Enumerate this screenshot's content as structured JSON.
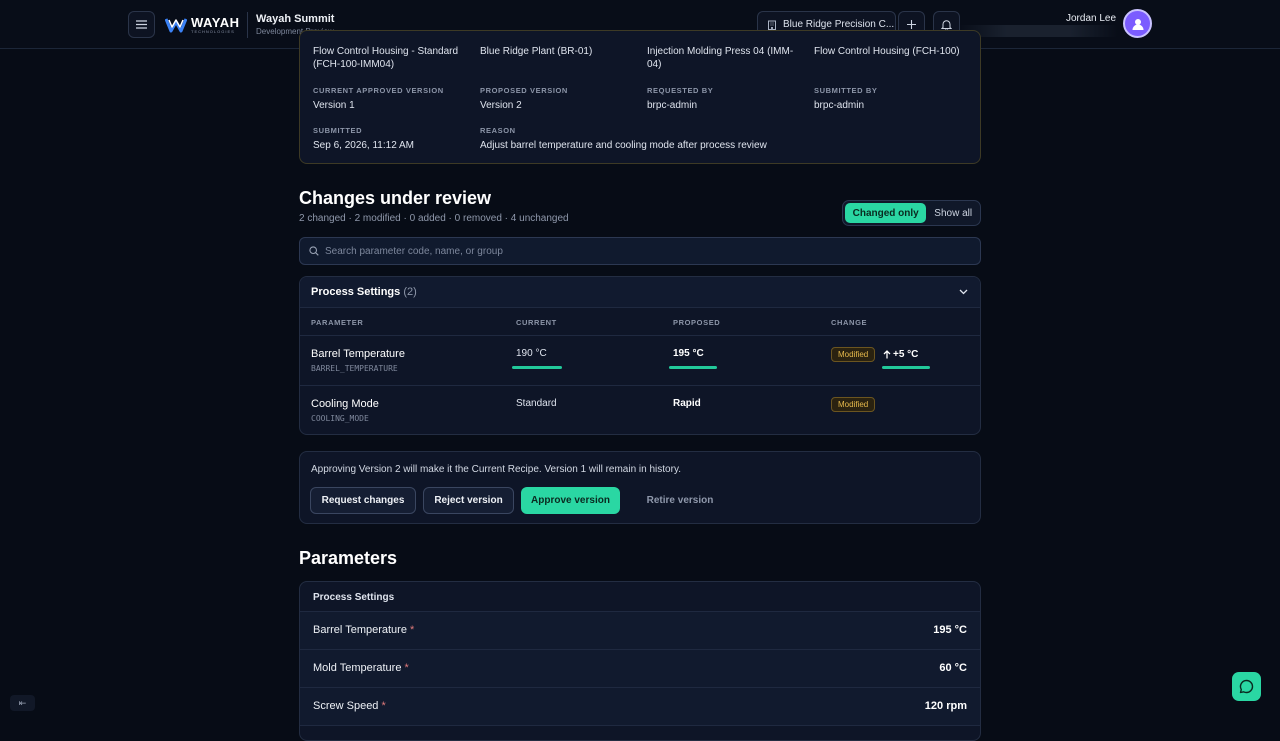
{
  "header": {
    "logo_word": "WAYAH",
    "logo_sub": "TECHNOLOGIES",
    "app_name": "Wayah Summit",
    "app_env": "Development Preview",
    "org_name": "Blue Ridge Precision C...",
    "user_name": "Jordan Lee"
  },
  "summary": {
    "recipe": "Flow Control Housing - Standard (FCH-100-IMM04)",
    "plant": "Blue Ridge Plant (BR-01)",
    "equipment": "Injection Molding Press 04 (IMM-04)",
    "product": "Flow Control Housing (FCH-100)",
    "current_version_label": "CURRENT APPROVED VERSION",
    "current_version": "Version 1",
    "proposed_version_label": "PROPOSED VERSION",
    "proposed_version": "Version 2",
    "requested_by_label": "REQUESTED BY",
    "requested_by": "brpc-admin",
    "submitted_by_label": "SUBMITTED BY",
    "submitted_by": "brpc-admin",
    "submitted_label": "SUBMITTED",
    "submitted": "Sep 6, 2026, 11:12 AM",
    "reason_label": "REASON",
    "reason": "Adjust barrel temperature and cooling mode after process review"
  },
  "changes": {
    "title": "Changes under review",
    "summary": "2 changed · 2 modified · 0 added · 0 removed · 4 unchanged",
    "toggle_on": "Changed only",
    "toggle_off": "Show all",
    "search_placeholder": "Search parameter code, name, or group",
    "group_name": "Process Settings",
    "group_count": "(2)",
    "columns": [
      "PARAMETER",
      "CURRENT",
      "PROPOSED",
      "CHANGE"
    ],
    "rows": [
      {
        "name": "Barrel Temperature",
        "code": "BARREL_TEMPERATURE",
        "current": "190 °C",
        "proposed": "195 °C",
        "badge": "Modified",
        "delta": "+5 °C"
      },
      {
        "name": "Cooling Mode",
        "code": "COOLING_MODE",
        "current": "Standard",
        "proposed": "Rapid",
        "badge": "Modified"
      }
    ]
  },
  "approval": {
    "text": "Approving Version 2 will make it the Current Recipe. Version 1 will remain in history.",
    "request_changes": "Request changes",
    "reject": "Reject version",
    "approve": "Approve version",
    "retire": "Retire version"
  },
  "parameters": {
    "title": "Parameters",
    "group_name": "Process Settings",
    "required_mark": "*",
    "rows": [
      {
        "name": "Barrel Temperature",
        "value": "195 °C"
      },
      {
        "name": "Mold Temperature",
        "value": "60 °C"
      },
      {
        "name": "Screw Speed",
        "value": "120 rpm"
      }
    ]
  },
  "footer": {
    "collapse_label": "⇤"
  },
  "colors": {
    "accent": "#2ad7a3",
    "background": "#070c16",
    "badge_text": "#e6b94b"
  }
}
